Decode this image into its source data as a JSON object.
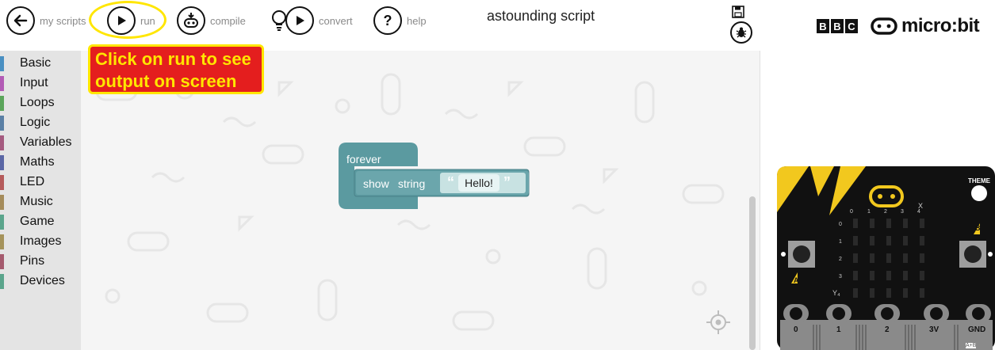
{
  "toolbar": {
    "my_scripts_label": "my scripts",
    "run_label": "run",
    "compile_label": "compile",
    "convert_label": "convert",
    "help_label": "help",
    "title": "astounding script"
  },
  "brand": {
    "bbc_letters": [
      "B",
      "B",
      "C"
    ],
    "name": "micro:bit"
  },
  "callout": {
    "text": "Click on run to see output on screen"
  },
  "sidebar": {
    "items": [
      {
        "label": "Basic",
        "color": "#4a90c2"
      },
      {
        "label": "Input",
        "color": "#b25bb5"
      },
      {
        "label": "Loops",
        "color": "#5ba55b"
      },
      {
        "label": "Logic",
        "color": "#5b80a5"
      },
      {
        "label": "Variables",
        "color": "#a55b80"
      },
      {
        "label": "Maths",
        "color": "#5b67a5"
      },
      {
        "label": "LED",
        "color": "#b55b5b"
      },
      {
        "label": "Music",
        "color": "#a58c5b"
      },
      {
        "label": "Game",
        "color": "#5ba58c"
      },
      {
        "label": "Images",
        "color": "#a5935b"
      },
      {
        "label": "Pins",
        "color": "#a55b6e"
      },
      {
        "label": "Devices",
        "color": "#5ba58c"
      }
    ]
  },
  "blocks": {
    "forever_label": "forever",
    "show_label": "show",
    "string_label": "string",
    "value": "Hello!",
    "color": "#5b9aa0"
  },
  "simulator": {
    "theme_label": "THEME",
    "button_a": "A",
    "button_b": "B",
    "col_labels": [
      "0",
      "1",
      "2",
      "3",
      "4"
    ],
    "row_labels": [
      "0",
      "1",
      "2",
      "3"
    ],
    "x_label": "X",
    "y_label": "Y₄",
    "pins": [
      "0",
      "1",
      "2",
      "3V",
      "GND"
    ],
    "ab_label": "A+B",
    "accent": "#f2c81e"
  },
  "icons": {
    "back": "arrow-left-icon",
    "run": "play-icon",
    "compile": "robot-download-icon",
    "convert": "lightbulb-play-icon",
    "help": "question-icon",
    "save": "floppy-disk-icon",
    "debug": "bug-icon",
    "target": "crosshair-icon"
  }
}
